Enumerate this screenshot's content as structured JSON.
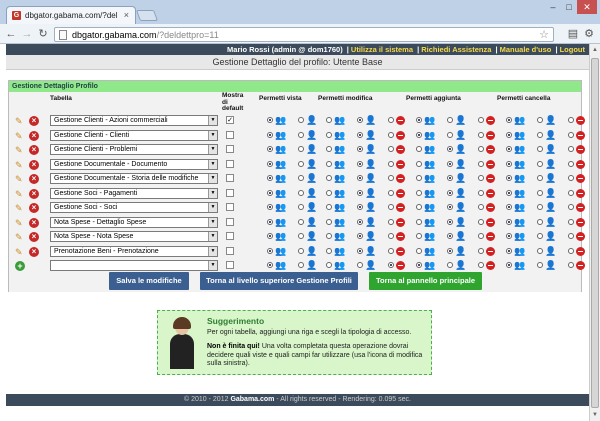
{
  "browser": {
    "tab_title": "dbgator.gabama.com/?del",
    "tab_close": "×",
    "url_host": "dbgator.gabama.com",
    "url_path": "/?deldettpro=11",
    "window_controls": [
      "–",
      "□",
      "✕"
    ]
  },
  "topbar": {
    "user": "Mario Rossi (admin @ dom1760)",
    "links": [
      "Utilizza il sistema",
      "Richiedi Assistenza",
      "Manuale d'uso",
      "Logout"
    ]
  },
  "page_title": "Gestione Dettaglio del profilo: Utente Base",
  "panel": {
    "title": "Gestione Dettaglio Profilo",
    "headers": {
      "tabella": "Tabella",
      "mostra": "Mostra di default",
      "vista": "Permetti vista",
      "modifica": "Permetti modifica",
      "aggiunta": "Permetti aggiunta",
      "cancella": "Permetti cancella"
    },
    "rows": [
      {
        "table": "Gestione Clienti - Azioni commerciali",
        "default": true,
        "sel": [
          0,
          1,
          0,
          0
        ]
      },
      {
        "table": "Gestione Clienti - Clienti",
        "default": false,
        "sel": [
          0,
          1,
          0,
          0
        ]
      },
      {
        "table": "Gestione Clienti - Problemi",
        "default": false,
        "sel": [
          0,
          1,
          1,
          0
        ]
      },
      {
        "table": "Gestione Documentale - Documento",
        "default": false,
        "sel": [
          0,
          1,
          1,
          0
        ]
      },
      {
        "table": "Gestione Documentale - Storia delle modifiche",
        "default": false,
        "sel": [
          0,
          1,
          1,
          0
        ]
      },
      {
        "table": "Gestione Soci - Pagamenti",
        "default": false,
        "sel": [
          0,
          1,
          1,
          0
        ]
      },
      {
        "table": "Gestione Soci - Soci",
        "default": false,
        "sel": [
          0,
          1,
          1,
          0
        ]
      },
      {
        "table": "Nota Spese - Dettaglio Spese",
        "default": false,
        "sel": [
          0,
          1,
          1,
          0
        ]
      },
      {
        "table": "Nota Spese - Nota Spese",
        "default": false,
        "sel": [
          0,
          1,
          1,
          0
        ]
      },
      {
        "table": "Prenotazione Beni - Prenotazione",
        "default": false,
        "sel": [
          0,
          1,
          1,
          0
        ]
      },
      {
        "table": "",
        "default": false,
        "sel": [
          0,
          2,
          0,
          0
        ],
        "new": true
      }
    ]
  },
  "buttons": {
    "save": "Salva le modifiche",
    "back": "Torna al livello superiore Gestione Profili",
    "main": "Torna al pannello principale"
  },
  "colors": {
    "save": "#3b5f91",
    "back": "#3b5f91",
    "main": "#2fa52f"
  },
  "tip": {
    "title": "Suggerimento",
    "line1": "Per ogni tabella, aggiungi una riga e scegli la tipologia di accesso.",
    "line2_bold": "Non è finita qui!",
    "line2": " Una volta completata questa operazione dovrai decidere quali viste e quali campi far utilizzare (usa l'icona di modifica sulla sinistra)."
  },
  "footer": {
    "pre": "© 2010 - 2012 ",
    "brand": "Gabama.com",
    "post": " - All rights reserved - Rendering: 0.095 sec."
  }
}
